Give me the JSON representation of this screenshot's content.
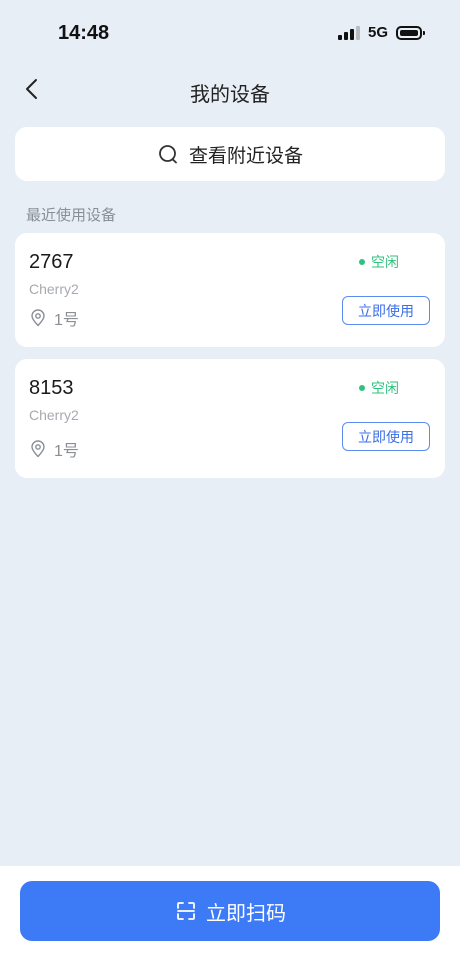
{
  "status_bar": {
    "time": "14:48",
    "network": "5G",
    "icons": [
      "signal-icon",
      "battery-icon"
    ]
  },
  "nav": {
    "title": "我的设备",
    "back_icon": "chevron-left-icon"
  },
  "search": {
    "label": "查看附近设备",
    "icon": "search-icon"
  },
  "recent_section": {
    "title": "最近使用设备"
  },
  "devices": [
    {
      "id": "2767",
      "model": "Cherry2",
      "location": "1号",
      "status": "空闲",
      "button_label": "立即使用"
    },
    {
      "id": "8153",
      "model": "Cherry2",
      "location": "1号",
      "status": "空闲",
      "button_label": "立即使用"
    }
  ],
  "bottom": {
    "scan_label": "立即扫码",
    "scan_icon": "scan-icon"
  },
  "colors": {
    "background": "#e8eef6",
    "accent": "#3d7af6",
    "status_idle": "#2ec27e"
  }
}
